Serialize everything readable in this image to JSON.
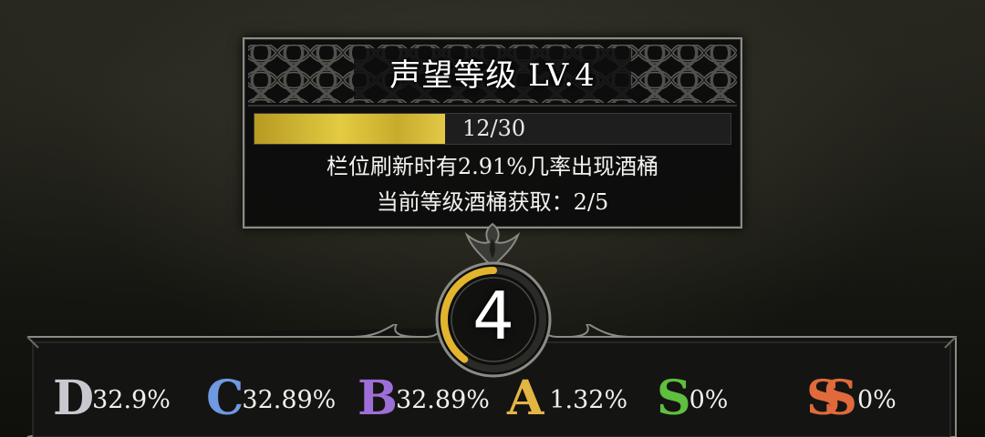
{
  "tooltip": {
    "title": "声望等级 LV.4",
    "progress": {
      "current": 12,
      "max": 30,
      "text": "12/30",
      "fraction": 0.4
    },
    "line1": "栏位刷新时有2.91%几率出现酒桶",
    "line2": "当前等级酒桶获取：2/5"
  },
  "badge": {
    "level": "4",
    "ring_progress": 0.4
  },
  "rarities": [
    {
      "grade": "D",
      "percent": "32.9%",
      "color": "#c9c8cf"
    },
    {
      "grade": "C",
      "percent": "32.89%",
      "color": "#6f99e0"
    },
    {
      "grade": "B",
      "percent": "32.89%",
      "color": "#9d6fd6"
    },
    {
      "grade": "A",
      "percent": "1.32%",
      "color": "#e3b542"
    },
    {
      "grade": "S",
      "percent": "0%",
      "color": "#5fbf3e"
    },
    {
      "grade": "SS",
      "percent": "0%",
      "color": "#e06a3b"
    }
  ],
  "colors": {
    "gold": "#e3cb42",
    "frame": "#8c8c86",
    "panel": "#0c0c0c"
  }
}
